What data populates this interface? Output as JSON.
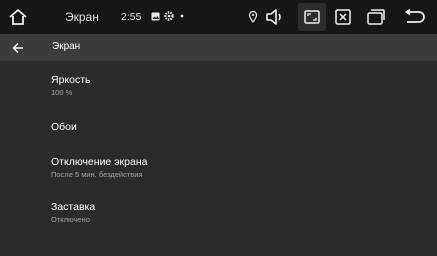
{
  "status_bar": {
    "app_name": "Экран",
    "time": "2:55",
    "icons": [
      "home-icon",
      "image-icon",
      "settings-gear-icon",
      "dot-icon",
      "location-pin-icon",
      "volume-icon",
      "screenshot-icon",
      "close-window-icon",
      "recent-apps-icon",
      "return-icon"
    ]
  },
  "header": {
    "title": "Экран"
  },
  "settings": [
    {
      "title": "Яркость",
      "subtitle": "100 %"
    },
    {
      "title": "Обои",
      "subtitle": ""
    },
    {
      "title": "Отключение экрана",
      "subtitle": "После 5 мин. бездействия"
    },
    {
      "title": "Заставка",
      "subtitle": "Отключено"
    }
  ],
  "colors": {
    "statusbar_bg": "#161616",
    "appbar_bg": "#3b3b3b",
    "content_bg": "#2b2b2b",
    "subtitle_text": "#a5a5a5"
  }
}
